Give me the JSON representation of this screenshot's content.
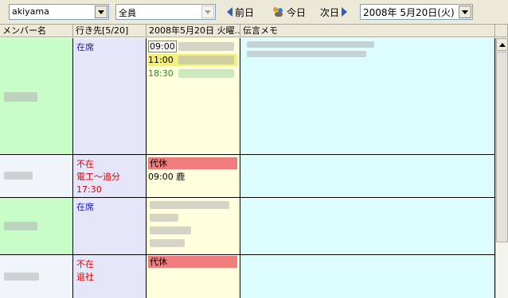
{
  "toolbar": {
    "user_select": "akiyama",
    "group_select": "全員",
    "prev_label": "前日",
    "today_label": "今日",
    "next_label": "次日",
    "date_select": "2008年  5月20日(火)"
  },
  "columns": {
    "member": "メンバー名",
    "destination": "行き先[5/20]",
    "schedule": "2008年5月20日 火曜...",
    "memo": "伝言メモ"
  },
  "rows": [
    {
      "destination": [
        "在席"
      ],
      "schedule": [
        "09:00",
        "11:00",
        "18:30"
      ]
    },
    {
      "destination": [
        "不在",
        "電工～追分",
        "17:30"
      ],
      "schedule_tag": "代休",
      "schedule": [
        "09:00 鹿"
      ]
    },
    {
      "destination": [
        "在席"
      ],
      "schedule": []
    },
    {
      "destination": [
        "不在",
        "退社"
      ],
      "schedule_tag": "代休",
      "schedule": []
    }
  ],
  "colors": {
    "present": "#1a1aa8",
    "absent": "#e00000",
    "member_green": "#c8fdc8",
    "destination_bg": "#e6e6fa",
    "schedule_bg": "#ffffde",
    "memo_bg": "#ddfcfe",
    "tag_bg": "#f07d7d"
  }
}
